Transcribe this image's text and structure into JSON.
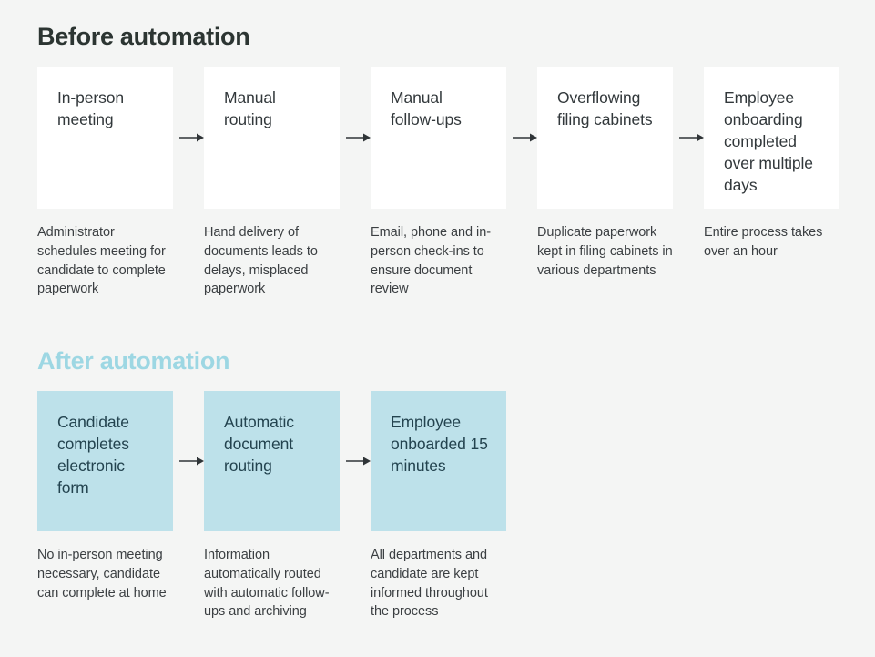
{
  "theme": {
    "background": "#f4f5f4",
    "box_white": "#ffffff",
    "box_blue": "#bde1ea",
    "title_dark": "#2c3532",
    "title_blue": "#9dd7e3",
    "text_dark": "#32383b",
    "text_blue_box": "#23434f",
    "caption": "#3b3f42",
    "arrow": "#2f3437"
  },
  "sections": [
    {
      "id": "before",
      "title": "Before automation",
      "steps": [
        {
          "label": "In-person meeting",
          "caption": "Administrator schedules meeting for candidate to complete paperwork"
        },
        {
          "label": "Manual routing",
          "caption": "Hand delivery of documents leads to delays, misplaced paperwork"
        },
        {
          "label": "Manual follow-ups",
          "caption": "Email, phone and in-person check-ins to ensure document review"
        },
        {
          "label": "Overflowing filing cabinets",
          "caption": "Duplicate paperwork kept in filing cabinets in various departments"
        },
        {
          "label": "Employee onboarding completed over multiple days",
          "caption": "Entire process takes over an hour"
        }
      ]
    },
    {
      "id": "after",
      "title": "After automation",
      "steps": [
        {
          "label": "Candidate completes electronic form",
          "caption": "No in-person meeting necessary, candidate can complete at home"
        },
        {
          "label": "Automatic document routing",
          "caption": "Information automatically routed with automatic follow-ups and archiving"
        },
        {
          "label": "Employee onboarded 15 minutes",
          "caption": "All departments and candidate are kept informed throughout the process"
        }
      ]
    }
  ]
}
